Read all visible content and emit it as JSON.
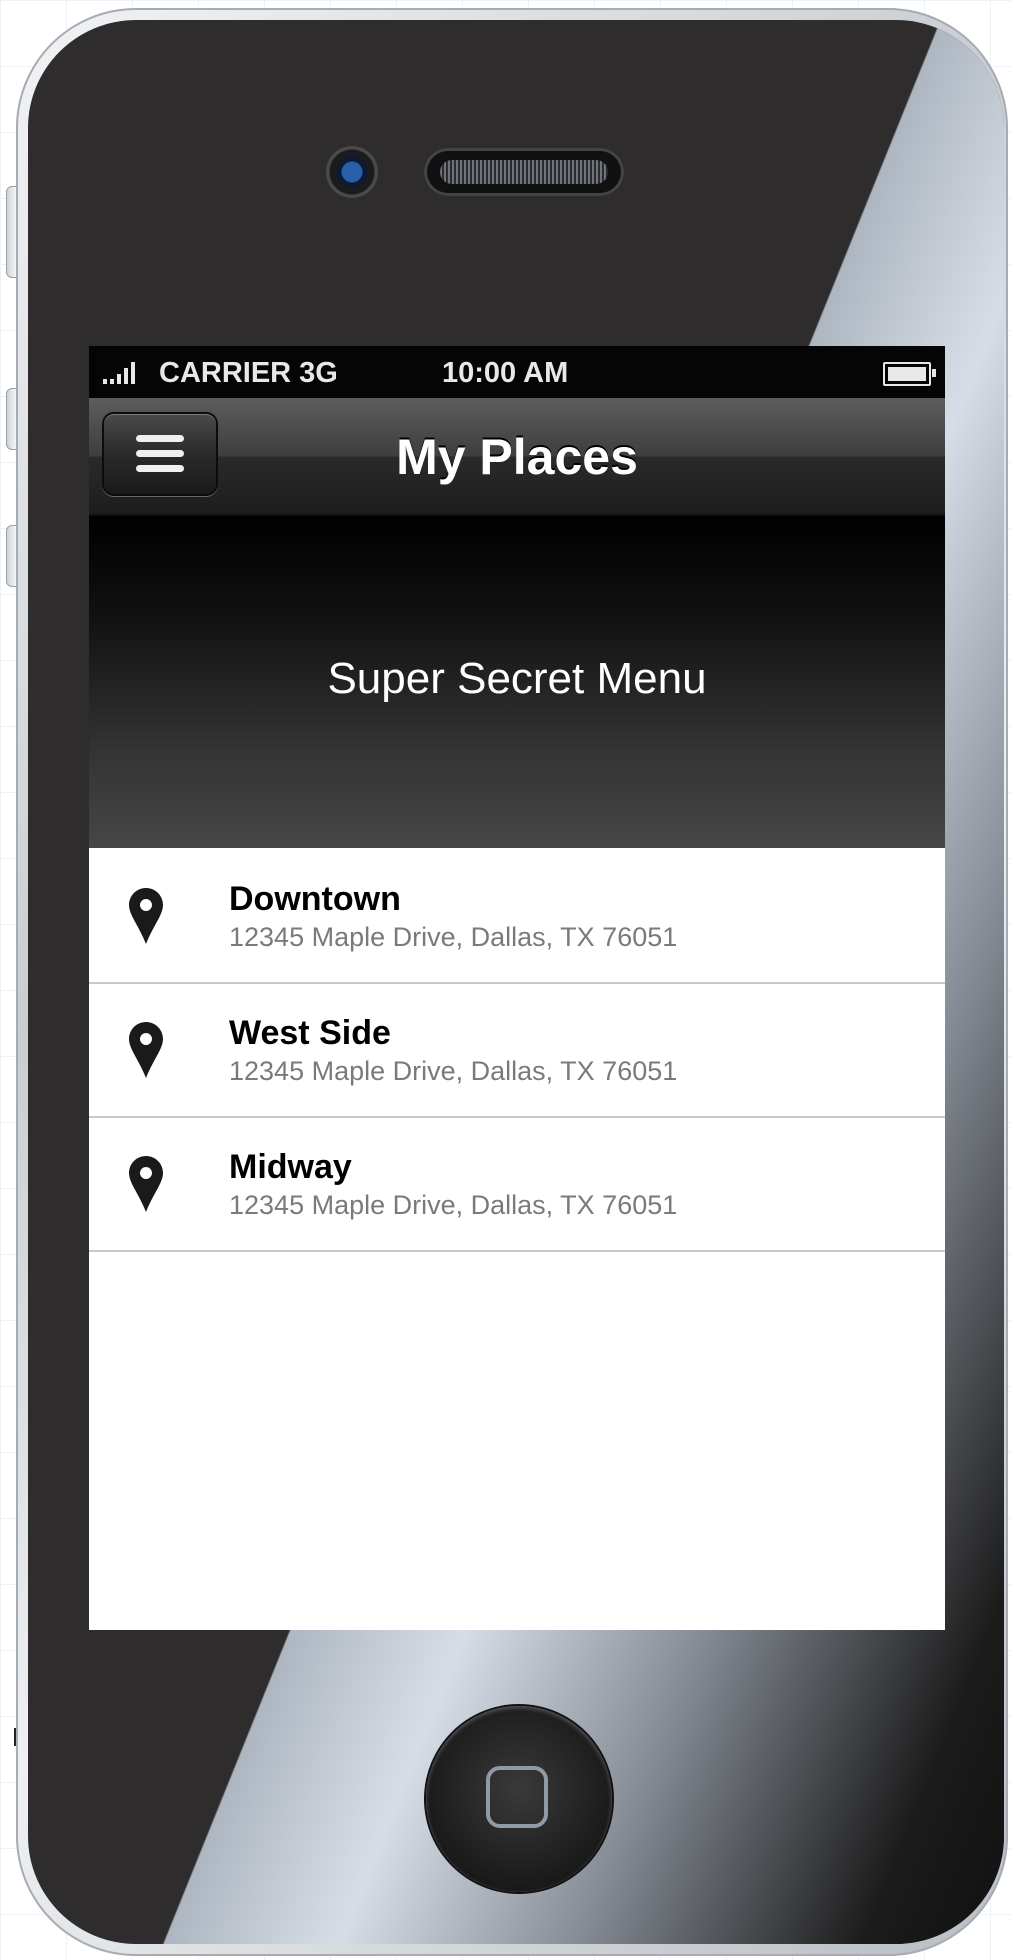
{
  "status_bar": {
    "carrier": "CARRIER 3G",
    "time": "10:00 AM"
  },
  "nav": {
    "title": "My Places",
    "menu_icon": "hamburger-menu-icon"
  },
  "secret_menu": {
    "label": "Super Secret Menu"
  },
  "places": [
    {
      "name": "Downtown",
      "address": "12345 Maple Drive, Dallas, TX 76051",
      "icon": "map-pin-icon"
    },
    {
      "name": "West Side",
      "address": "12345 Maple Drive, Dallas, TX 76051",
      "icon": "map-pin-icon"
    },
    {
      "name": "Midway",
      "address": "12345 Maple Drive, Dallas, TX 76051",
      "icon": "map-pin-icon"
    }
  ],
  "colors": {
    "status_bar_bg": "#050505",
    "nav_bar_top": "#5d5d5d",
    "nav_bar_bottom": "#1d1d1d",
    "list_bg": "#ffffff",
    "address_text": "#7a7a7a",
    "divider": "#c9c9c9"
  }
}
